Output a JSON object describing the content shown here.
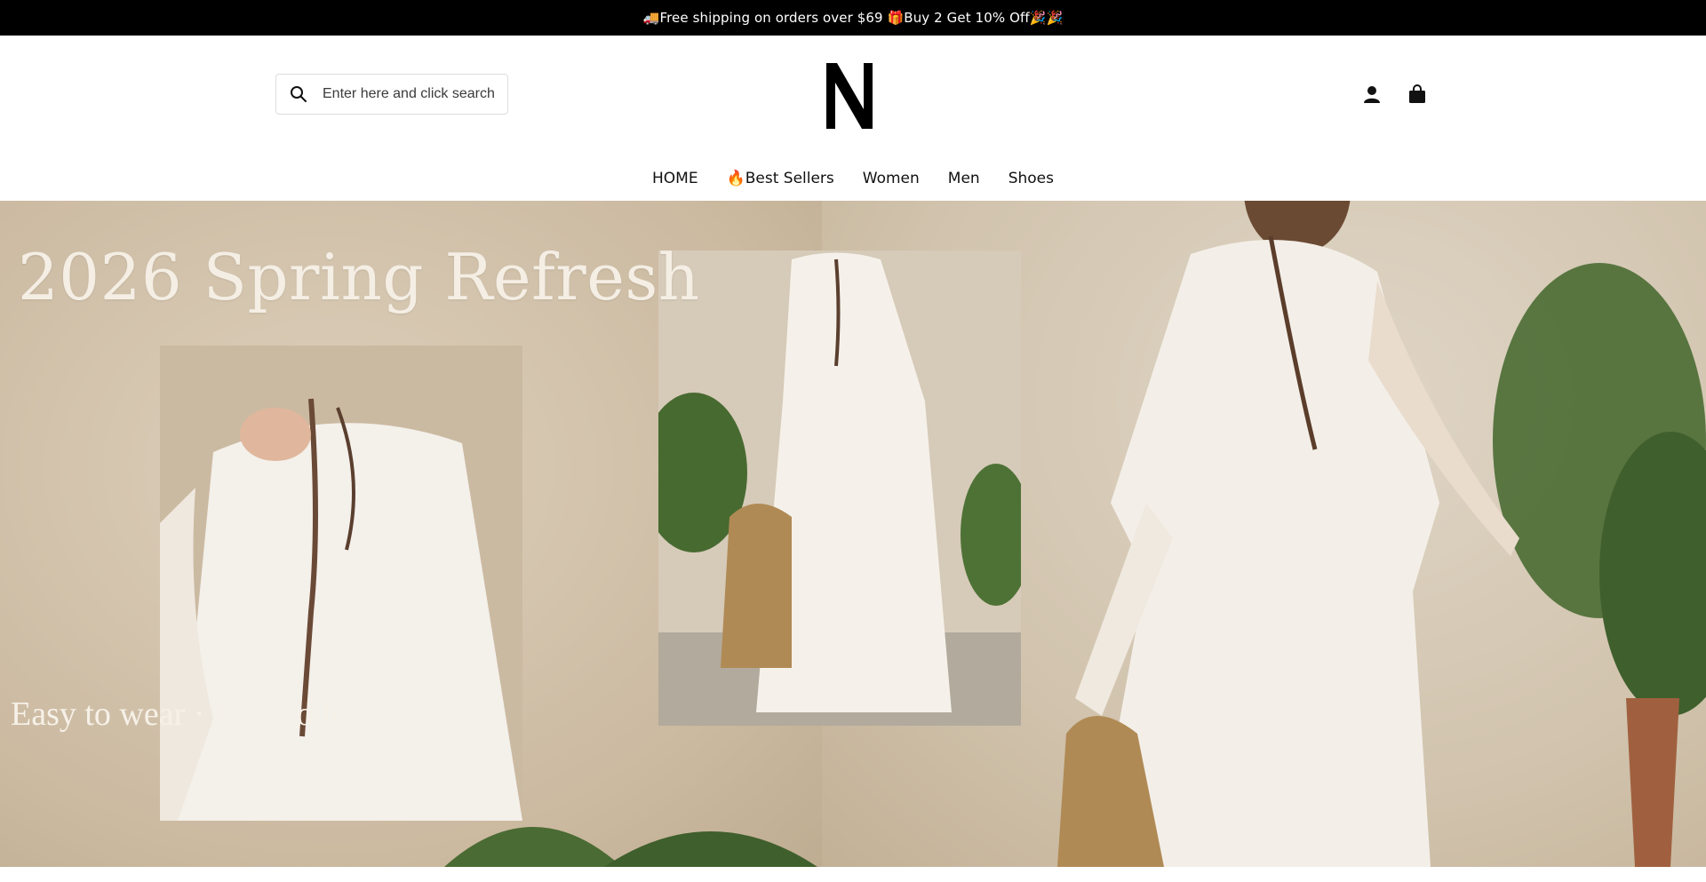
{
  "announcement": {
    "text": "🚚Free shipping on orders over $69 🎁Buy 2 Get 10% Off🎉🎉"
  },
  "search": {
    "placeholder": "Enter here and click search"
  },
  "logo": {
    "letter": "N"
  },
  "header_icons": {
    "account": "account-icon",
    "cart": "cart-icon"
  },
  "nav": {
    "items": [
      {
        "label": "HOME"
      },
      {
        "label": "🔥Best Sellers"
      },
      {
        "label": "Women"
      },
      {
        "label": "Men"
      },
      {
        "label": "Shoes"
      }
    ]
  },
  "hero": {
    "title": "2026 Spring Refresh",
    "tagline": "Easy to wear · Easy to love"
  },
  "colors": {
    "announcement_bg": "#000000",
    "announcement_text": "#ffffff",
    "hero_wall": "#d3c4ae",
    "dress": "#f3efe8",
    "basket": "#b08a55",
    "plant": "#4a6b33"
  }
}
